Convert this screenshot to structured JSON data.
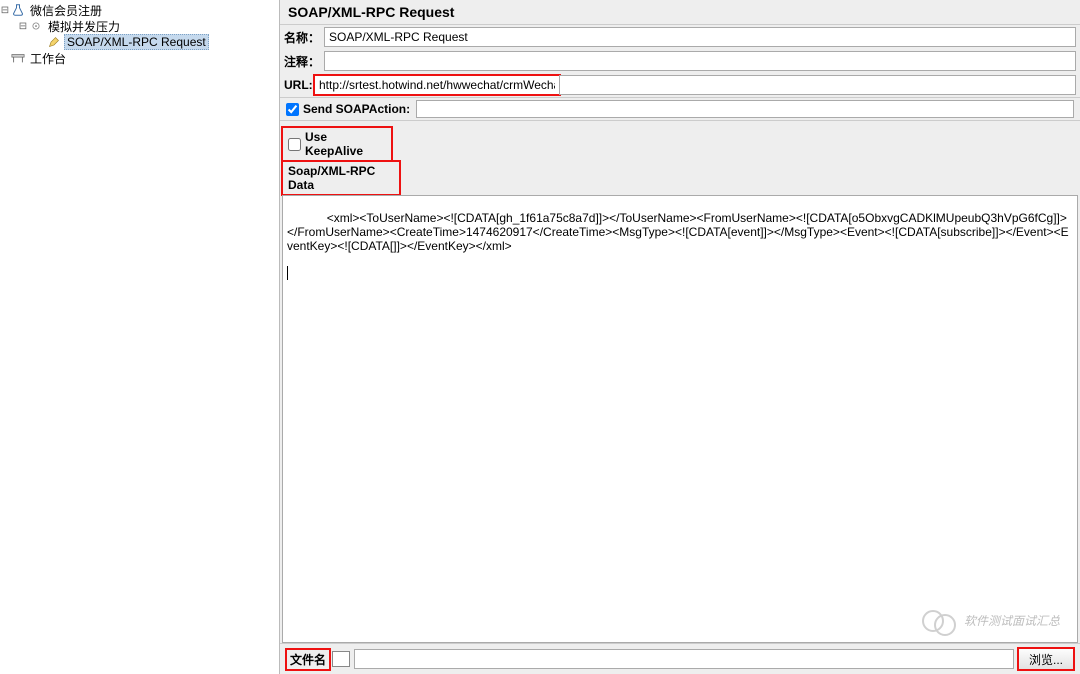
{
  "tree": {
    "root": "微信会员注册",
    "group": "模拟并发压力",
    "leaf": "SOAP/XML-RPC Request",
    "workbench": "工作台"
  },
  "panel": {
    "title": "SOAP/XML-RPC Request",
    "name_label": "名称：",
    "name_value": "SOAP/XML-RPC Request",
    "comment_label": "注释：",
    "comment_value": "",
    "url_label": "URL:",
    "url_value": "http://srtest.hotwind.net/hwwechat/crmWechat.do",
    "send_soapaction": "Send SOAPAction:",
    "use_keepalive": "Use KeepAlive",
    "data_header": "Soap/XML-RPC Data",
    "xml_body": "<xml><ToUserName><![CDATA[gh_1f61a75c8a7d]]></ToUserName><FromUserName><![CDATA[o5ObxvgCADKlMUpeubQ3hVpG6fCg]]></FromUserName><CreateTime>1474620917</CreateTime><MsgType><![CDATA[event]]></MsgType><Event><![CDATA[subscribe]]></Event><EventKey><![CDATA[]]></EventKey></xml>",
    "filename_label": "文件名",
    "browse_label": "浏览..."
  },
  "watermark": "软件测试面试汇总"
}
